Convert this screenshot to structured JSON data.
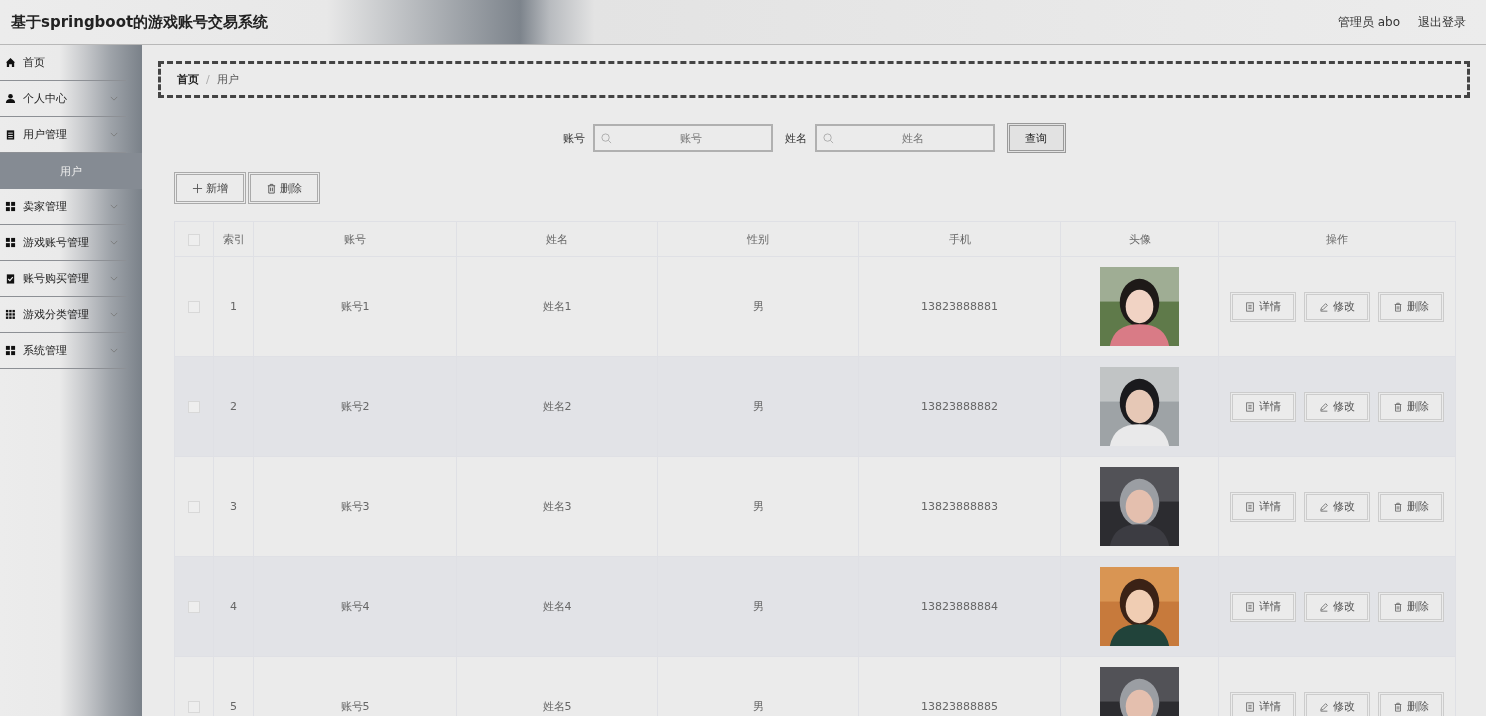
{
  "header": {
    "title": "基于springboot的游戏账号交易系统",
    "user": "管理员 abo",
    "logout": "退出登录"
  },
  "sidebar": {
    "items": [
      {
        "kind": "link",
        "label": "首页"
      },
      {
        "kind": "submenu",
        "label": "个人中心"
      },
      {
        "kind": "submenu",
        "label": "用户管理",
        "children": [
          {
            "label": "用户",
            "selected": true
          }
        ]
      },
      {
        "kind": "submenu",
        "label": "卖家管理"
      },
      {
        "kind": "submenu",
        "label": "游戏账号管理"
      },
      {
        "kind": "submenu",
        "label": "账号购买管理"
      },
      {
        "kind": "submenu",
        "label": "游戏分类管理"
      },
      {
        "kind": "submenu",
        "label": "系统管理"
      }
    ]
  },
  "breadcrumb": {
    "separator": "/",
    "items": [
      "首页",
      "用户"
    ]
  },
  "search": [
    {
      "label": "账号",
      "placeholder": "账号"
    },
    {
      "label": "姓名",
      "placeholder": "姓名"
    }
  ],
  "query_button": "查询",
  "toolbar": {
    "add": "新增",
    "delete": "删除"
  },
  "table": {
    "all_checked": false,
    "columns": [
      "索引",
      "账号",
      "姓名",
      "性别",
      "手机",
      "头像",
      "操作"
    ],
    "rows": [
      {
        "checked": false,
        "index": "1",
        "account": "账号1",
        "name": "姓名1",
        "gender": "男",
        "phone": "13823888881",
        "actions": [
          "详情",
          "修改",
          "删除"
        ]
      },
      {
        "checked": false,
        "index": "2",
        "account": "账号2",
        "name": "姓名2",
        "gender": "男",
        "phone": "13823888882",
        "actions": [
          "详情",
          "修改",
          "删除"
        ]
      },
      {
        "checked": false,
        "index": "3",
        "account": "账号3",
        "name": "姓名3",
        "gender": "男",
        "phone": "13823888883",
        "actions": [
          "详情",
          "修改",
          "删除"
        ]
      },
      {
        "checked": false,
        "index": "4",
        "account": "账号4",
        "name": "姓名4",
        "gender": "男",
        "phone": "13823888884",
        "actions": [
          "详情",
          "修改",
          "删除"
        ]
      },
      {
        "checked": false,
        "index": "5",
        "account": "账号5",
        "name": "姓名5",
        "gender": "男",
        "phone": "13823888885",
        "actions": [
          "详情",
          "修改",
          "删除"
        ]
      }
    ]
  }
}
